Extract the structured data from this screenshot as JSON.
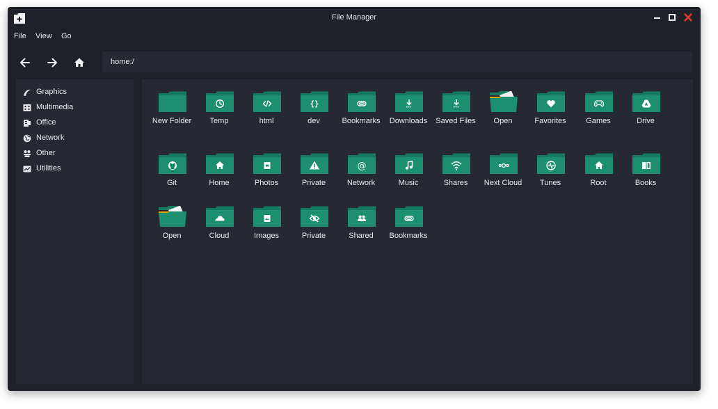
{
  "window": {
    "title": "File Manager"
  },
  "menu": [
    "File",
    "View",
    "Go"
  ],
  "address": {
    "value": "home:/"
  },
  "sidebar": {
    "items": [
      {
        "label": "Graphics",
        "icon": "graphics-icon"
      },
      {
        "label": "Multimedia",
        "icon": "multimedia-icon"
      },
      {
        "label": "Office",
        "icon": "office-icon"
      },
      {
        "label": "Network",
        "icon": "network-icon"
      },
      {
        "label": "Other",
        "icon": "other-icon"
      },
      {
        "label": "Utilities",
        "icon": "utilities-icon"
      }
    ]
  },
  "folders": [
    {
      "label": "New Folder",
      "icon": "none"
    },
    {
      "label": "Temp",
      "icon": "clock"
    },
    {
      "label": "html",
      "icon": "code"
    },
    {
      "label": "dev",
      "icon": "braces"
    },
    {
      "label": "Bookmarks",
      "icon": "paperclip"
    },
    {
      "label": "Downloads",
      "icon": "download"
    },
    {
      "label": "Saved Files",
      "icon": "download"
    },
    {
      "label": "Open",
      "icon": "open"
    },
    {
      "label": "Favorites",
      "icon": "heart"
    },
    {
      "label": "Games",
      "icon": "gamepad"
    },
    {
      "label": "Drive",
      "icon": "drive"
    },
    {
      "label": "Git",
      "icon": "github"
    },
    {
      "label": "Home",
      "icon": "home"
    },
    {
      "label": "Photos",
      "icon": "photo"
    },
    {
      "label": "Private",
      "icon": "warning"
    },
    {
      "label": "Network",
      "icon": "at"
    },
    {
      "label": "Music",
      "icon": "music"
    },
    {
      "label": "Shares",
      "icon": "wifi"
    },
    {
      "label": "Next Cloud",
      "icon": "nextcloud"
    },
    {
      "label": "Tunes",
      "icon": "pulse"
    },
    {
      "label": "Root",
      "icon": "home"
    },
    {
      "label": "Books",
      "icon": "book"
    },
    {
      "label": "Open",
      "icon": "open"
    },
    {
      "label": "Cloud",
      "icon": "cloud"
    },
    {
      "label": "Images",
      "icon": "image"
    },
    {
      "label": "Private",
      "icon": "eye-off"
    },
    {
      "label": "Shared",
      "icon": "people"
    },
    {
      "label": "Bookmarks",
      "icon": "paperclip"
    }
  ],
  "colors": {
    "window_bg": "#1f2128",
    "panel_bg": "#262932",
    "folder": "#1b8f6e",
    "folder_back": "#167b5e",
    "close": "#e53935",
    "open_stripe": "#e0a800"
  }
}
